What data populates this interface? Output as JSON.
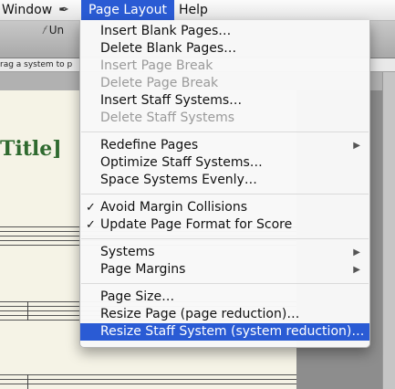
{
  "menubar": {
    "window_label": "Window",
    "script_icon": "script-icon",
    "page_layout_label": "Page Layout",
    "help_label": "Help"
  },
  "document": {
    "tab_label": "Un",
    "status_text": "rag a system to p",
    "title_text": "Title]"
  },
  "menu": {
    "groups": [
      [
        {
          "label": "Insert Blank Pages…",
          "enabled": true
        },
        {
          "label": "Delete Blank Pages…",
          "enabled": true
        },
        {
          "label": "Insert Page Break",
          "enabled": false
        },
        {
          "label": "Delete Page Break",
          "enabled": false
        },
        {
          "label": "Insert Staff Systems…",
          "enabled": true
        },
        {
          "label": "Delete Staff Systems",
          "enabled": false
        }
      ],
      [
        {
          "label": "Redefine Pages",
          "enabled": true,
          "submenu": true
        },
        {
          "label": "Optimize Staff Systems…",
          "enabled": true
        },
        {
          "label": "Space Systems Evenly…",
          "enabled": true
        }
      ],
      [
        {
          "label": "Avoid Margin Collisions",
          "enabled": true,
          "checked": true
        },
        {
          "label": "Update Page Format for Score",
          "enabled": true,
          "checked": true
        }
      ],
      [
        {
          "label": "Systems",
          "enabled": true,
          "submenu": true
        },
        {
          "label": "Page Margins",
          "enabled": true,
          "submenu": true
        }
      ],
      [
        {
          "label": "Page Size…",
          "enabled": true
        },
        {
          "label": "Resize Page (page reduction)…",
          "enabled": true
        },
        {
          "label": "Resize Staff System (system reduction)…",
          "enabled": true,
          "highlighted": true
        }
      ]
    ]
  },
  "colors": {
    "highlight": "#2a5bd4",
    "title_green": "#2f6a2f",
    "page_bg": "#f5f3e6"
  }
}
